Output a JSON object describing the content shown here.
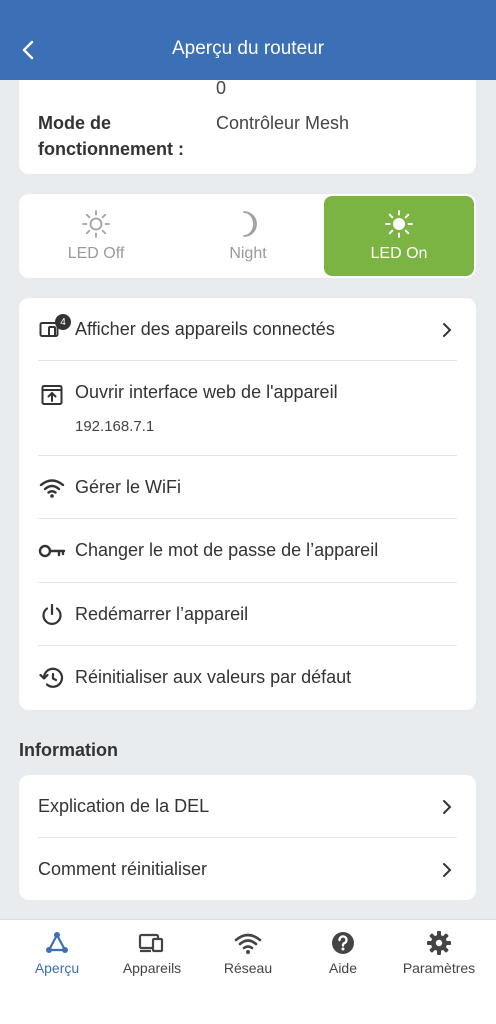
{
  "header": {
    "title": "Aperçu du routeur"
  },
  "info": {
    "prev_value": "0",
    "mode_label": "Mode de fonctionnement :",
    "mode_value": "Contrôleur Mesh"
  },
  "led": {
    "options": [
      {
        "label": "LED Off",
        "icon": "sun-outline-icon"
      },
      {
        "label": "Night",
        "icon": "moon-icon"
      },
      {
        "label": "LED On",
        "icon": "sun-icon"
      }
    ],
    "selected": "LED On",
    "accent": "#7cb444"
  },
  "menu": {
    "connected_devices": {
      "label": "Afficher des appareils connectés",
      "badge": "4"
    },
    "web_interface": {
      "label": "Ouvrir interface web de l'appareil",
      "ip": "192.168.7.1"
    },
    "wifi": {
      "label": "Gérer le WiFi"
    },
    "password": {
      "label": "Changer le mot de passe de l’appareil"
    },
    "reboot": {
      "label": "Redémarrer l’appareil"
    },
    "reset": {
      "label": "Réinitialiser aux valeurs par défaut"
    }
  },
  "information": {
    "title": "Information",
    "items": [
      {
        "label": "Explication de la DEL"
      },
      {
        "label": "Comment réinitialiser"
      }
    ]
  },
  "nav": {
    "items": [
      {
        "label": "Aperçu",
        "icon": "mesh-icon",
        "active": true
      },
      {
        "label": "Appareils",
        "icon": "devices-icon"
      },
      {
        "label": "Réseau",
        "icon": "wifi-icon"
      },
      {
        "label": "Aide",
        "icon": "help-icon"
      },
      {
        "label": "Paramètres",
        "icon": "gear-icon"
      }
    ]
  },
  "colors": {
    "header_bg": "#3b6fb6",
    "active_nav": "#3b6fb6",
    "led_on_bg": "#7cb444"
  }
}
